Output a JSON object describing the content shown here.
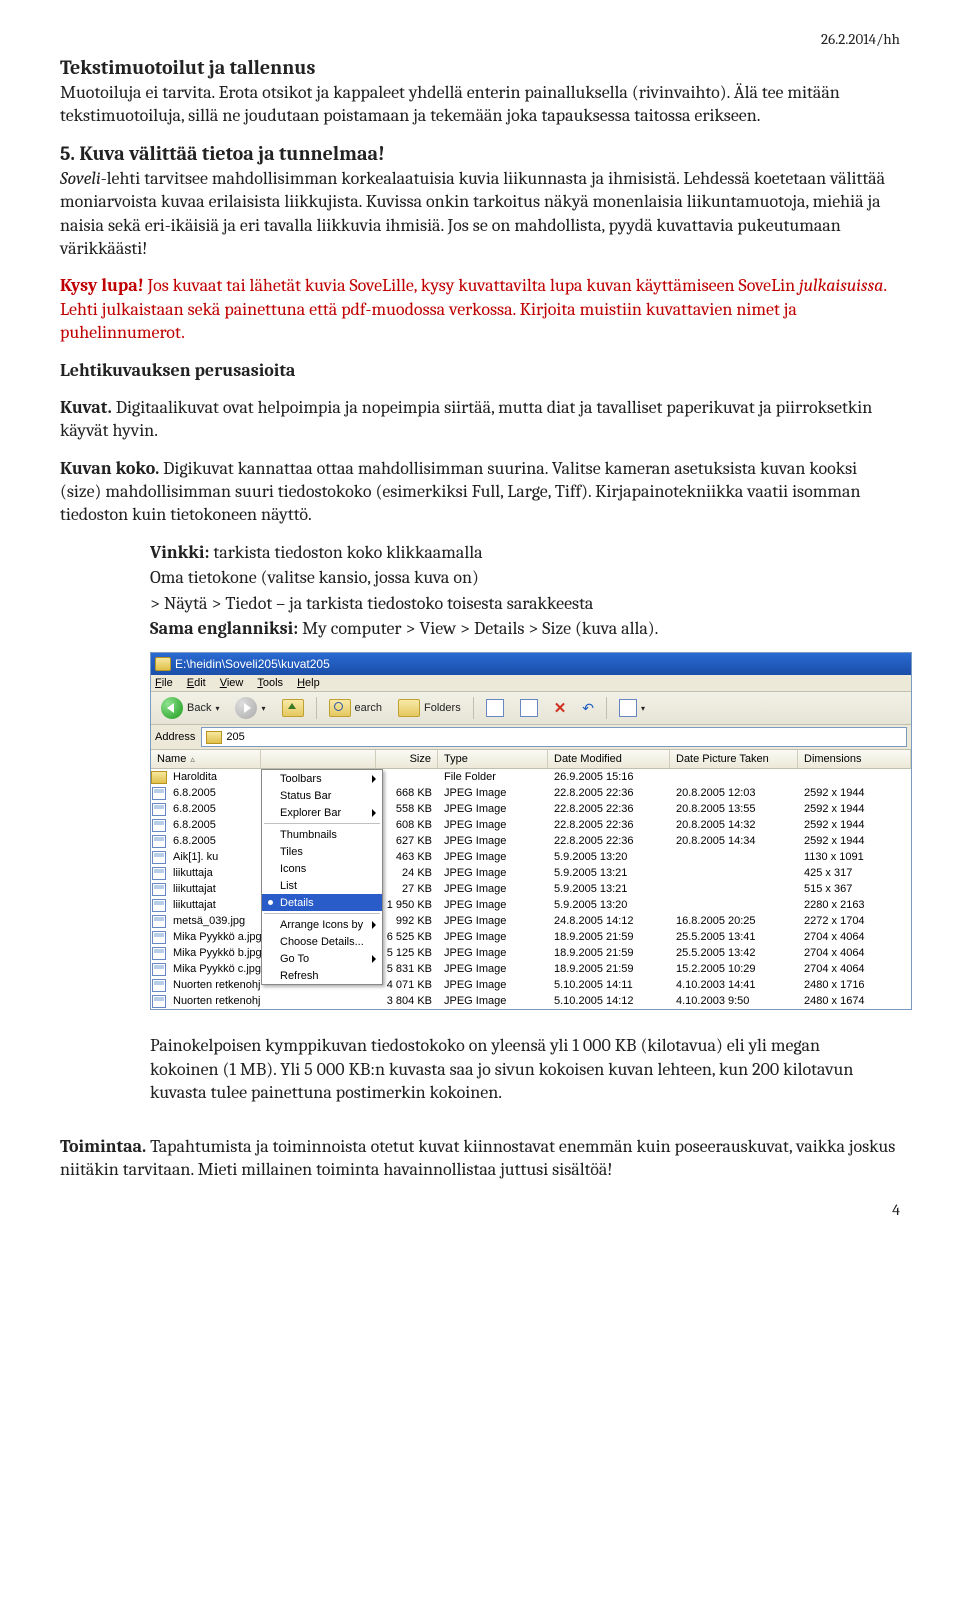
{
  "header_date": "26.2.2014/hh",
  "section1": {
    "title": "Tekstimuotoilut ja tallennus",
    "p1": "Muotoiluja ei tarvita. Erota otsikot ja kappaleet yhdellä enterin painalluksella (rivinvaihto). Älä tee mitään tekstimuotoiluja, sillä ne joudutaan poistamaan ja tekemään joka tapauksessa taitossa erikseen."
  },
  "section2": {
    "title": "5. Kuva välittää tietoa ja tunnelmaa!",
    "p1_italic_lead": "Soveli",
    "p1_rest": "-lehti tarvitsee mahdollisimman korkealaatuisia kuvia liikunnasta ja ihmisistä. Lehdessä koetetaan välittää moniarvoista kuvaa erilaisista liikkujista. Kuvissa onkin tarkoitus näkyä monenlaisia liikuntamuotoja, miehiä ja naisia sekä eri-ikäisiä ja eri tavalla liikkuvia ihmisiä. Jos se on mahdollista, pyydä kuvattavia pukeutumaan värikkäästi!",
    "p2_boldred": "Kysy lupa!",
    "p2_red_a": " Jos kuvaat tai lähetät kuvia SoveLille, kysy kuvattavilta lupa kuvan käyttämiseen SoveLin ",
    "p2_red_italic": "julkaisuissa",
    "p2_red_b": ". Lehti julkaistaan sekä painettuna että pdf-muodossa verkossa. Kirjoita muistiin kuvattavien nimet ja puhelinnumerot.",
    "p3_bold": "Lehtikuvauksen perusasioita",
    "p4_bold": "Kuvat.",
    "p4_body": " Digitaalikuvat ovat helpoimpia ja nopeimpia siirtää, mutta diat ja tavalliset paperikuvat ja piirroksetkin käyvät hyvin.",
    "p5_bold": "Kuvan koko.",
    "p5_body": " Digikuvat kannattaa ottaa mahdollisimman suurina. Valitse kameran asetuksista kuvan kooksi (size) mahdollisimman suuri tiedostokoko (esimerkiksi Full, Large, Tiff). Kirjapainotekniikka vaatii isomman tiedoston kuin tietokoneen näyttö."
  },
  "vinkki": {
    "l1_bold": "Vinkki:",
    "l1_rest": " tarkista tiedoston koko klikkaamalla",
    "l2": "Oma tietokone (valitse kansio, jossa kuva on)",
    "l3": "> Näytä > Tiedot – ja tarkista tiedostoko toisesta sarakkeesta",
    "l4_bold": "Sama englanniksi:",
    "l4_rest": " My computer > View > Details > Size (kuva alla)."
  },
  "explorer": {
    "titlebar": "E:\\heidin\\Soveli205\\kuvat205",
    "menu": [
      "File",
      "Edit",
      "View",
      "Tools",
      "Help"
    ],
    "toolbar": {
      "back": "Back",
      "search_label": "earch",
      "folders": "Folders"
    },
    "address_label": "Address",
    "address_value": "205",
    "columns": [
      "Name",
      "Size",
      "Type",
      "Date Modified",
      "Date Picture Taken",
      "Dimensions"
    ],
    "view_menu": {
      "items": [
        {
          "label": "Toolbars",
          "submenu": true
        },
        {
          "label": "Status Bar"
        },
        {
          "label": "Explorer Bar",
          "submenu": true
        }
      ],
      "items2": [
        {
          "label": "Thumbnails"
        },
        {
          "label": "Tiles"
        },
        {
          "label": "Icons"
        },
        {
          "label": "List"
        },
        {
          "label": "Details",
          "selected": true
        }
      ],
      "items3": [
        {
          "label": "Arrange Icons by",
          "submenu": true
        },
        {
          "label": "Choose Details..."
        },
        {
          "label": "Go To",
          "submenu": true
        },
        {
          "label": "Refresh"
        }
      ]
    },
    "rows": [
      {
        "name": "Haroldita",
        "type": "File Folder",
        "date": "26.9.2005 15:16",
        "folder": true
      },
      {
        "name": "6.8.2005",
        "size": "668 KB",
        "type": "JPEG Image",
        "date": "22.8.2005 22:36",
        "taken": "20.8.2005 12:03",
        "dim": "2592 x 1944"
      },
      {
        "name": "6.8.2005",
        "size": "558 KB",
        "type": "JPEG Image",
        "date": "22.8.2005 22:36",
        "taken": "20.8.2005 13:55",
        "dim": "2592 x 1944"
      },
      {
        "name": "6.8.2005",
        "size": "608 KB",
        "type": "JPEG Image",
        "date": "22.8.2005 22:36",
        "taken": "20.8.2005 14:32",
        "dim": "2592 x 1944"
      },
      {
        "name": "6.8.2005",
        "size": "627 KB",
        "type": "JPEG Image",
        "date": "22.8.2005 22:36",
        "taken": "20.8.2005 14:34",
        "dim": "2592 x 1944"
      },
      {
        "name": "Aik[1]. ku",
        "size": "463 KB",
        "type": "JPEG Image",
        "date": "5.9.2005 13:20",
        "dim": "1130 x 1091"
      },
      {
        "name": "liikuttaja",
        "size": "24 KB",
        "type": "JPEG Image",
        "date": "5.9.2005 13:21",
        "dim": "425 x 317"
      },
      {
        "name": "liikuttajat",
        "size": "27 KB",
        "type": "JPEG Image",
        "date": "5.9.2005 13:21",
        "dim": "515 x 367"
      },
      {
        "name": "liikuttajat",
        "size": "1 950 KB",
        "type": "JPEG Image",
        "date": "5.9.2005 13:20",
        "dim": "2280 x 2163"
      },
      {
        "name": "metsä_039.jpg",
        "size": "992 KB",
        "type": "JPEG Image",
        "date": "24.8.2005 14:12",
        "taken": "16.8.2005 20:25",
        "dim": "2272 x 1704"
      },
      {
        "name": "Mika Pyykkö a.jpg",
        "size": "6 525 KB",
        "type": "JPEG Image",
        "date": "18.9.2005 21:59",
        "taken": "25.5.2005 13:41",
        "dim": "2704 x 4064"
      },
      {
        "name": "Mika Pyykkö b.jpg",
        "size": "5 125 KB",
        "type": "JPEG Image",
        "date": "18.9.2005 21:59",
        "taken": "25.5.2005 13:42",
        "dim": "2704 x 4064"
      },
      {
        "name": "Mika Pyykkö c.jpg",
        "size": "5 831 KB",
        "type": "JPEG Image",
        "date": "18.9.2005 21:59",
        "taken": "15.2.2005 10:29",
        "dim": "2704 x 4064"
      },
      {
        "name": "Nuorten retkenohjaajakurs...",
        "size": "4 071 KB",
        "type": "JPEG Image",
        "date": "5.10.2005 14:11",
        "taken": "4.10.2003 14:41",
        "dim": "2480 x 1716"
      },
      {
        "name": "Nuorten retkenohjaajakurs...",
        "size": "3 804 KB",
        "type": "JPEG Image",
        "date": "5.10.2005 14:12",
        "taken": "4.10.2003 9:50",
        "dim": "2480 x 1674"
      }
    ]
  },
  "after_screenshot": {
    "p1": "Painokelpoisen kymppikuvan tiedostokoko on yleensä yli 1 000 KB (kilotavua) eli yli megan kokoinen (1 MB). Yli 5 000 KB:n kuvasta saa jo sivun kokoisen kuvan lehteen, kun 200 kilotavun kuvasta tulee painettuna postimerkin kokoinen."
  },
  "toimintaa": {
    "bold": "Toimintaa.",
    "body": " Tapahtumista ja toiminnoista otetut kuvat kiinnostavat enemmän kuin poseerauskuvat, vaikka joskus niitäkin tarvitaan. Mieti millainen toiminta havainnollistaa juttusi sisältöä!"
  },
  "pagenum": "4"
}
